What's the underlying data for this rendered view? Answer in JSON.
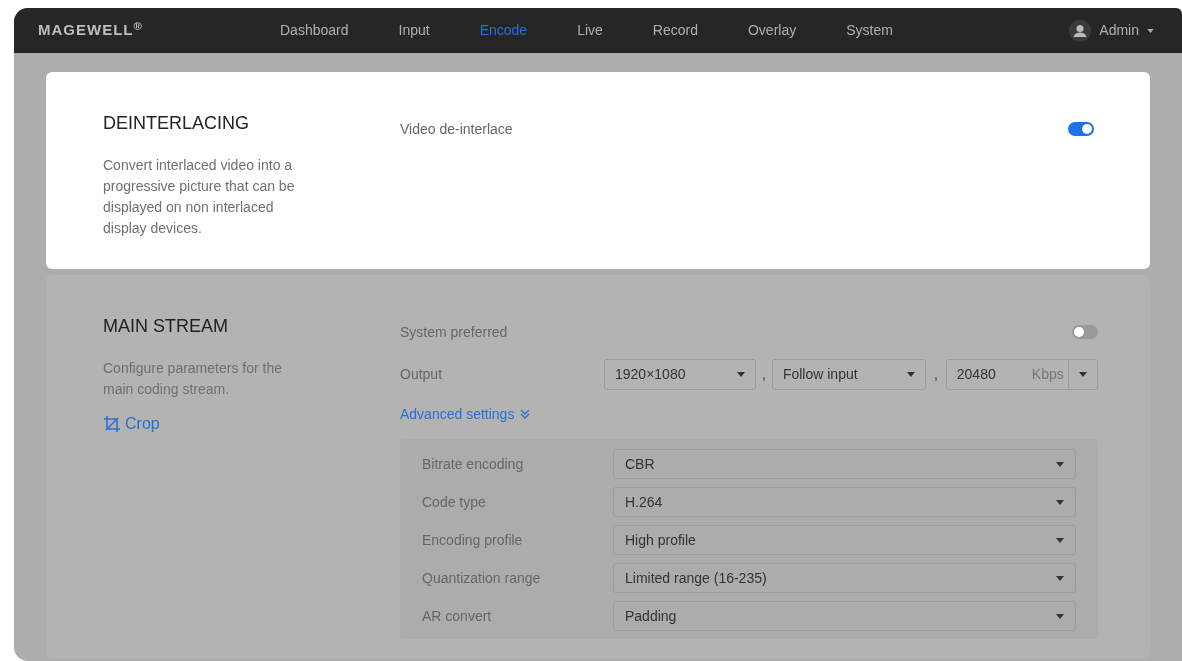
{
  "brand": "MAGEWELL$^{®}$",
  "nav": [
    {
      "label": "Dashboard",
      "selected": false
    },
    {
      "label": "Input",
      "selected": false
    },
    {
      "label": "Encode",
      "selected": true
    },
    {
      "label": "Live",
      "selected": false
    },
    {
      "label": "Record",
      "selected": false
    },
    {
      "label": "Overlay",
      "selected": false
    },
    {
      "label": "System",
      "selected": false
    }
  ],
  "user": {
    "name": "Admin"
  },
  "sections": [
    {
      "title": "DEINTERLACING",
      "description": "Convert interlaced video into a progressive picture that can be displayed on non interlaced display devices.",
      "highlighted": true,
      "settings": [
        {
          "kind": "toggle",
          "label": "Video de-interlace",
          "on": true
        }
      ]
    },
    {
      "title": "MAIN STREAM",
      "description": "Configure parameters for the main coding stream.",
      "link": "Crop",
      "highlighted": false,
      "settings": [
        {
          "kind": "toggle",
          "label": "System preferred",
          "on": false
        },
        {
          "kind": "output",
          "label": "Output",
          "resolution": "1920×1080",
          "frame_rate": "Follow input",
          "bitrate": "20480",
          "unit": "Kbps",
          "separators": [
            ",",
            ","
          ]
        }
      ],
      "advanced": {
        "label": "Advanced settings",
        "expanded": true,
        "fields": [
          {
            "label": "Bitrate encoding",
            "value": "CBR"
          },
          {
            "label": "Code type",
            "value": "H.264"
          },
          {
            "label": "Encoding profile",
            "value": "High profile"
          },
          {
            "label": "Quantization range",
            "value": "Limited range (16-235)"
          },
          {
            "label": "AR convert",
            "value": "Padding"
          }
        ]
      }
    }
  ]
}
